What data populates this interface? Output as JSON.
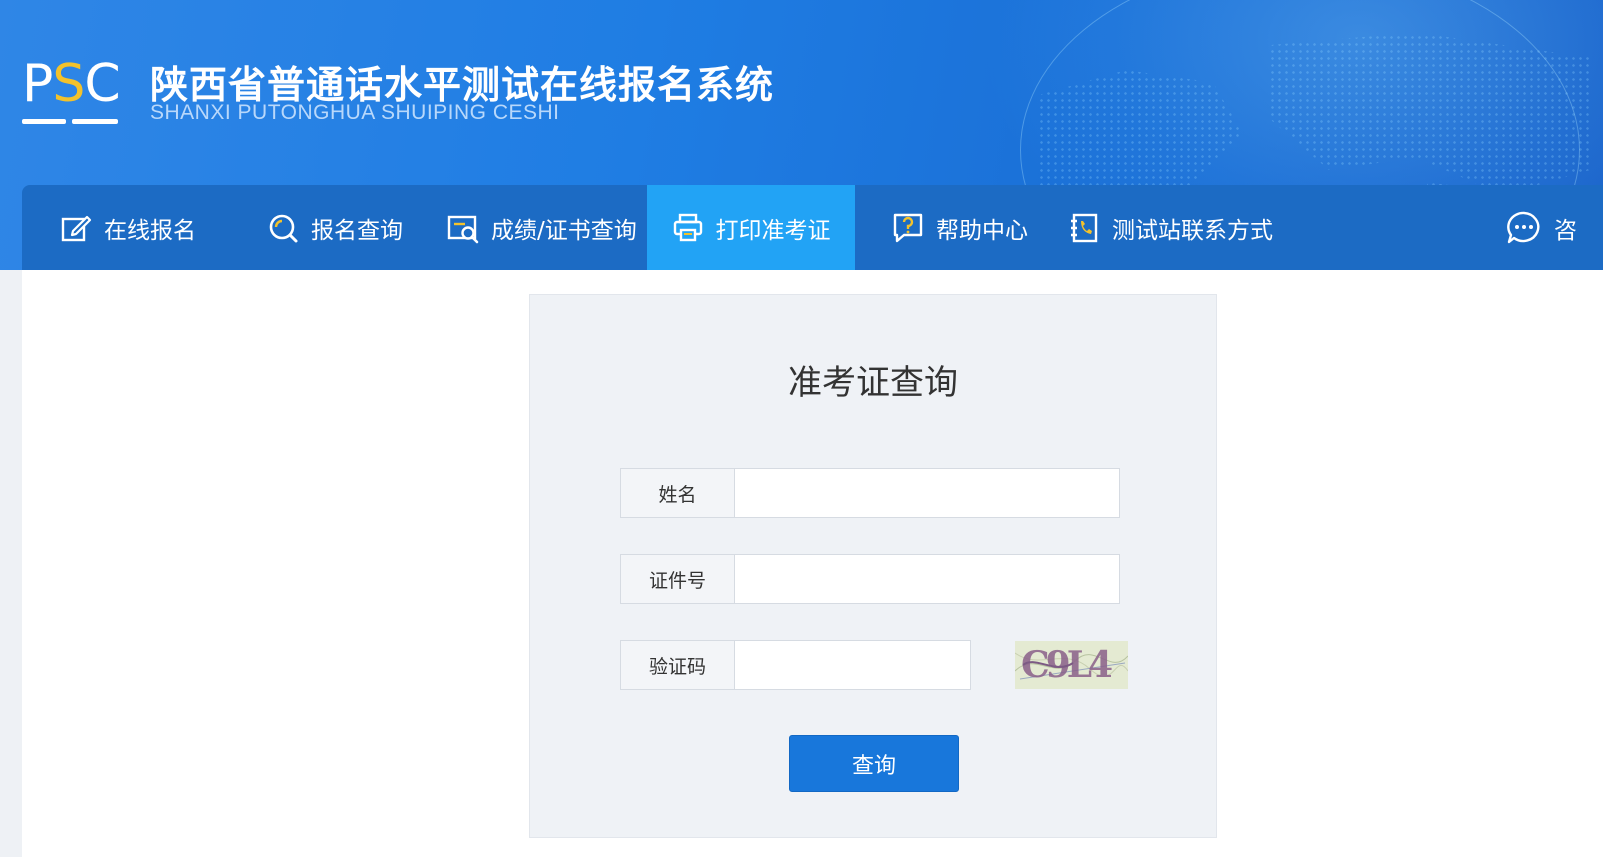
{
  "header": {
    "logo_text": "PSC",
    "title": "陕西省普通话水平测试在线报名系统",
    "subtitle": "SHANXI PUTONGHUA SHUIPING CESHI"
  },
  "nav": {
    "items": [
      {
        "label": "在线报名",
        "icon": "edit-icon"
      },
      {
        "label": "报名查询",
        "icon": "search-icon"
      },
      {
        "label": "成绩/证书查询",
        "icon": "certificate-search-icon"
      },
      {
        "label": "打印准考证",
        "icon": "printer-icon",
        "active": true
      },
      {
        "label": "帮助中心",
        "icon": "help-icon"
      },
      {
        "label": "测试站联系方式",
        "icon": "contact-book-icon"
      },
      {
        "label": "咨",
        "icon": "chat-icon"
      }
    ]
  },
  "form": {
    "title": "准考证查询",
    "fields": [
      {
        "label": "姓名",
        "value": ""
      },
      {
        "label": "证件号",
        "value": ""
      },
      {
        "label": "验证码",
        "value": ""
      }
    ],
    "captcha_text": "C9L4",
    "submit_label": "查询"
  },
  "colors": {
    "header_blue": "#1f7de3",
    "nav_blue": "#1c6bc4",
    "nav_active": "#22a3f5",
    "logo_yellow": "#f3c22b",
    "button_blue": "#1877db"
  }
}
